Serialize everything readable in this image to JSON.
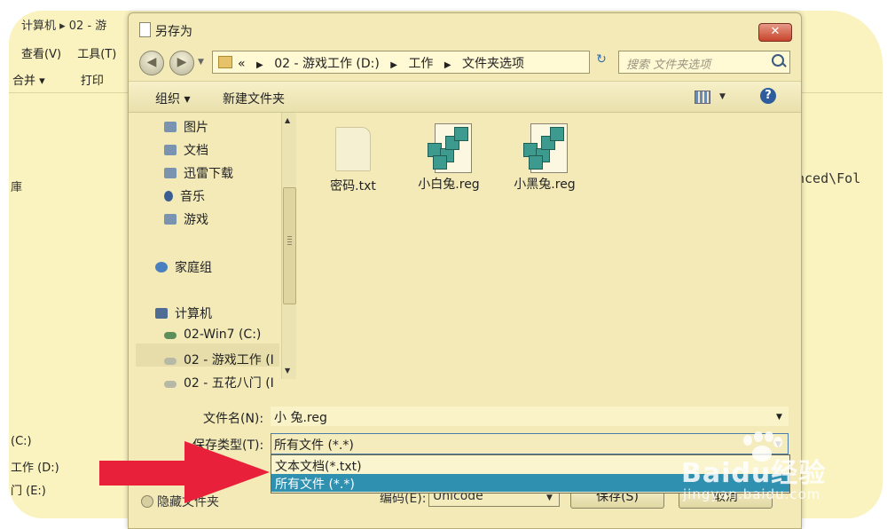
{
  "background_window": {
    "breadcrumb": "计算机 ▸ 02 - 游",
    "menu": [
      "查看(V)",
      "工具(T)"
    ],
    "toolbar": [
      "合并 ▾",
      "打印"
    ],
    "code_text": "nced\\Fol",
    "quote_text": "”",
    "left_char": "庫",
    "drives": [
      "(C:)",
      "工作 (D:)",
      "门 (E:)"
    ]
  },
  "dialog": {
    "title": "另存为",
    "close_label": "✕",
    "address": {
      "prefix": "«",
      "crumbs": [
        "02 - 游戏工作 (D:)",
        "工作",
        "文件夹选项"
      ]
    },
    "search_placeholder": "搜索 文件夹选项",
    "toolbar": {
      "organize": "组织 ▾",
      "new_folder": "新建文件夹",
      "help": "?"
    },
    "nav_tree": {
      "libraries": [
        "图片",
        "文档",
        "迅雷下载",
        "音乐",
        "游戏"
      ],
      "homegroup": "家庭组",
      "computer": "计算机",
      "drives": [
        "02-Win7 (C:)",
        "02 - 游戏工作 (I",
        "02 - 五花八门 (I"
      ]
    },
    "files": [
      "密码.txt",
      "小白兔.reg",
      "小黑兔.reg"
    ],
    "form": {
      "filename_label": "文件名(N):",
      "filename_value": "小   兔.reg",
      "filetype_label": "保存类型(T):",
      "filetype_value": "所有文件 (*.*)",
      "filetype_options": [
        "文本文档(*.txt)",
        "所有文件 (*.*)"
      ],
      "hide_folders": "隐藏文件夹",
      "encoding_label": "编码(E):",
      "encoding_value": "Unicode",
      "save_button": "保存(S)",
      "cancel_button": "取消"
    }
  },
  "watermark": {
    "brand": "Baidu经验",
    "url": "jingyan.baidu.com"
  },
  "colors": {
    "background": "#fbf3bd",
    "selection": "#2f90b0",
    "arrow": "#e8203a"
  }
}
